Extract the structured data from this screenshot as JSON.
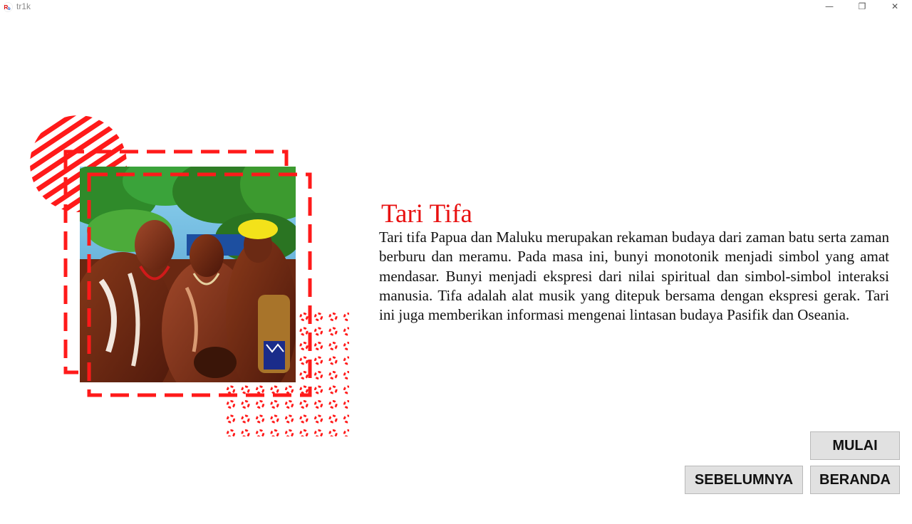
{
  "window": {
    "title": "tr1k",
    "app_icon_text": "Rb",
    "controls": {
      "minimize": "—",
      "maximize": "❐",
      "close": "✕"
    }
  },
  "content": {
    "heading": "Tari Tifa",
    "body": "Tari tifa Papua dan Maluku merupakan rekaman budaya dari zaman batu serta zaman berburu dan meramu. Pada masa ini, bunyi monotonik menjadi simbol yang amat mendasar. Bunyi menjadi ekspresi dari nilai spiritual dan simbol-simbol interaksi manusia. Tifa adalah alat musik yang ditepuk bersama dengan ekspresi gerak. Tari ini juga memberikan informasi mengenai lintasan budaya Pasifik dan Oseania."
  },
  "buttons": {
    "start": "MULAI",
    "previous": "SEBELUMNYA",
    "home": "BERANDA"
  },
  "colors": {
    "accent": "#ff1a1a",
    "heading": "#e81010",
    "button_bg": "#e1e1e1"
  },
  "photo": {
    "subject": "Papuan tifa dancers with drums"
  }
}
